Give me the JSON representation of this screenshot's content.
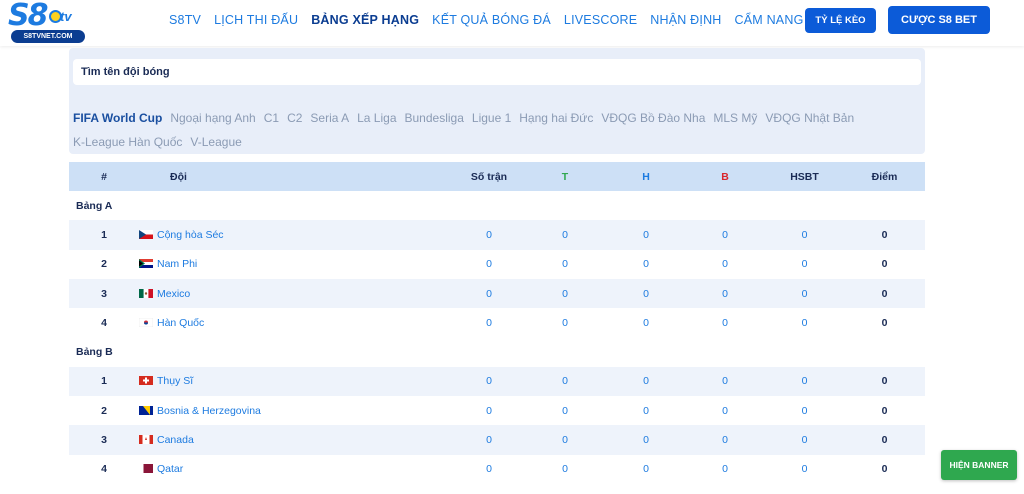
{
  "header": {
    "logo_text": "S8",
    "logo_tv": "tv",
    "logo_site": "S8TVNET.COM",
    "nav": [
      {
        "label": "S8TV"
      },
      {
        "label": "LỊCH THI ĐẤU"
      },
      {
        "label": "BẢNG XẾP HẠNG"
      },
      {
        "label": "KẾT QUẢ BÓNG ĐÁ"
      },
      {
        "label": "LIVESCORE"
      },
      {
        "label": "NHẬN ĐỊNH"
      },
      {
        "label": "CẨM NANG"
      }
    ],
    "active_nav": "BẢNG XẾP HẠNG",
    "odds_button": "TỶ LỆ KÈO",
    "bet_button": "CƯỢC S8 BET"
  },
  "search": {
    "placeholder": "Tìm tên đội bóng"
  },
  "leagues": [
    "FIFA World Cup",
    "Ngoại hạng Anh",
    "C1",
    "C2",
    "Seria A",
    "La Liga",
    "Bundesliga",
    "Ligue 1",
    "Hạng hai Đức",
    "VĐQG Bồ Đào Nha",
    "MLS Mỹ",
    "VĐQG Nhật Bản",
    "K-League Hàn Quốc",
    "V-League"
  ],
  "active_league": "FIFA World Cup",
  "table": {
    "headers": {
      "rank": "#",
      "team": "Đội",
      "played": "Số trận",
      "w": "T",
      "d": "H",
      "l": "B",
      "gd": "HSBT",
      "pts": "Điểm"
    },
    "header_colors": {
      "w": "#2fa84f",
      "d": "#1d7be0",
      "l": "#d9262c"
    },
    "groups": [
      {
        "name": "Bảng A",
        "rows": [
          {
            "rank": "1",
            "team": "Cộng hòa Séc",
            "flag": "cz-flag",
            "played": "0",
            "w": "0",
            "d": "0",
            "l": "0",
            "gd": "0",
            "pts": "0"
          },
          {
            "rank": "2",
            "team": "Nam Phi",
            "flag": "za-flag",
            "played": "0",
            "w": "0",
            "d": "0",
            "l": "0",
            "gd": "0",
            "pts": "0"
          },
          {
            "rank": "3",
            "team": "Mexico",
            "flag": "mx-flag",
            "played": "0",
            "w": "0",
            "d": "0",
            "l": "0",
            "gd": "0",
            "pts": "0"
          },
          {
            "rank": "4",
            "team": "Hàn Quốc",
            "flag": "kr-flag",
            "played": "0",
            "w": "0",
            "d": "0",
            "l": "0",
            "gd": "0",
            "pts": "0"
          }
        ]
      },
      {
        "name": "Bảng B",
        "rows": [
          {
            "rank": "1",
            "team": "Thụy Sĩ",
            "flag": "ch-flag",
            "played": "0",
            "w": "0",
            "d": "0",
            "l": "0",
            "gd": "0",
            "pts": "0"
          },
          {
            "rank": "2",
            "team": "Bosnia & Herzegovina",
            "flag": "ba-flag",
            "played": "0",
            "w": "0",
            "d": "0",
            "l": "0",
            "gd": "0",
            "pts": "0"
          },
          {
            "rank": "3",
            "team": "Canada",
            "flag": "ca-flag",
            "played": "0",
            "w": "0",
            "d": "0",
            "l": "0",
            "gd": "0",
            "pts": "0"
          },
          {
            "rank": "4",
            "team": "Qatar",
            "flag": "qa-flag",
            "played": "0",
            "w": "0",
            "d": "0",
            "l": "0",
            "gd": "0",
            "pts": "0"
          }
        ]
      }
    ]
  },
  "banner_button": "HIỆN BANNER"
}
